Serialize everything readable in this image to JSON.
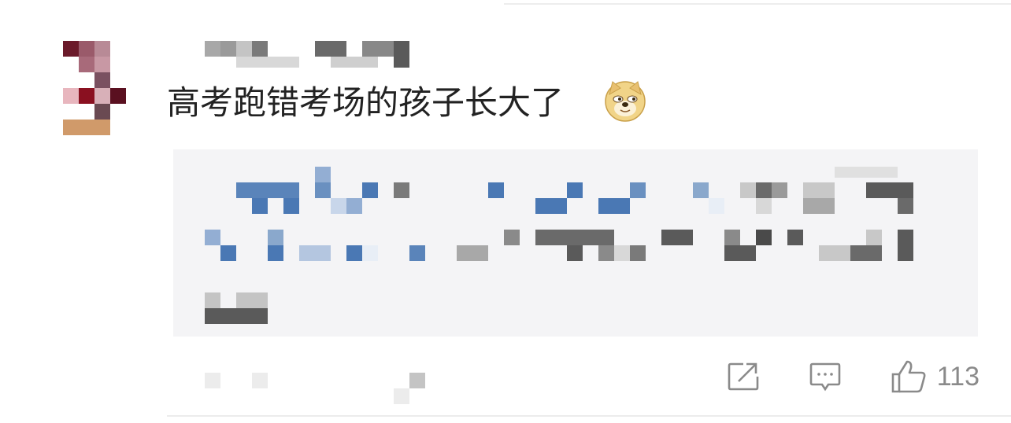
{
  "comment": {
    "text": "高考跑错考场的孩子长大了",
    "emoji": "doge-emoji"
  },
  "actions": {
    "share_icon": "share-icon",
    "reply_icon": "comment-icon",
    "like_icon": "thumbs-up-icon",
    "like_count": "113"
  },
  "colors": {
    "text": "#222222",
    "muted": "#8a8a8a",
    "quote_bg": "#f4f4f6",
    "link_blue": "#4a78b4"
  }
}
